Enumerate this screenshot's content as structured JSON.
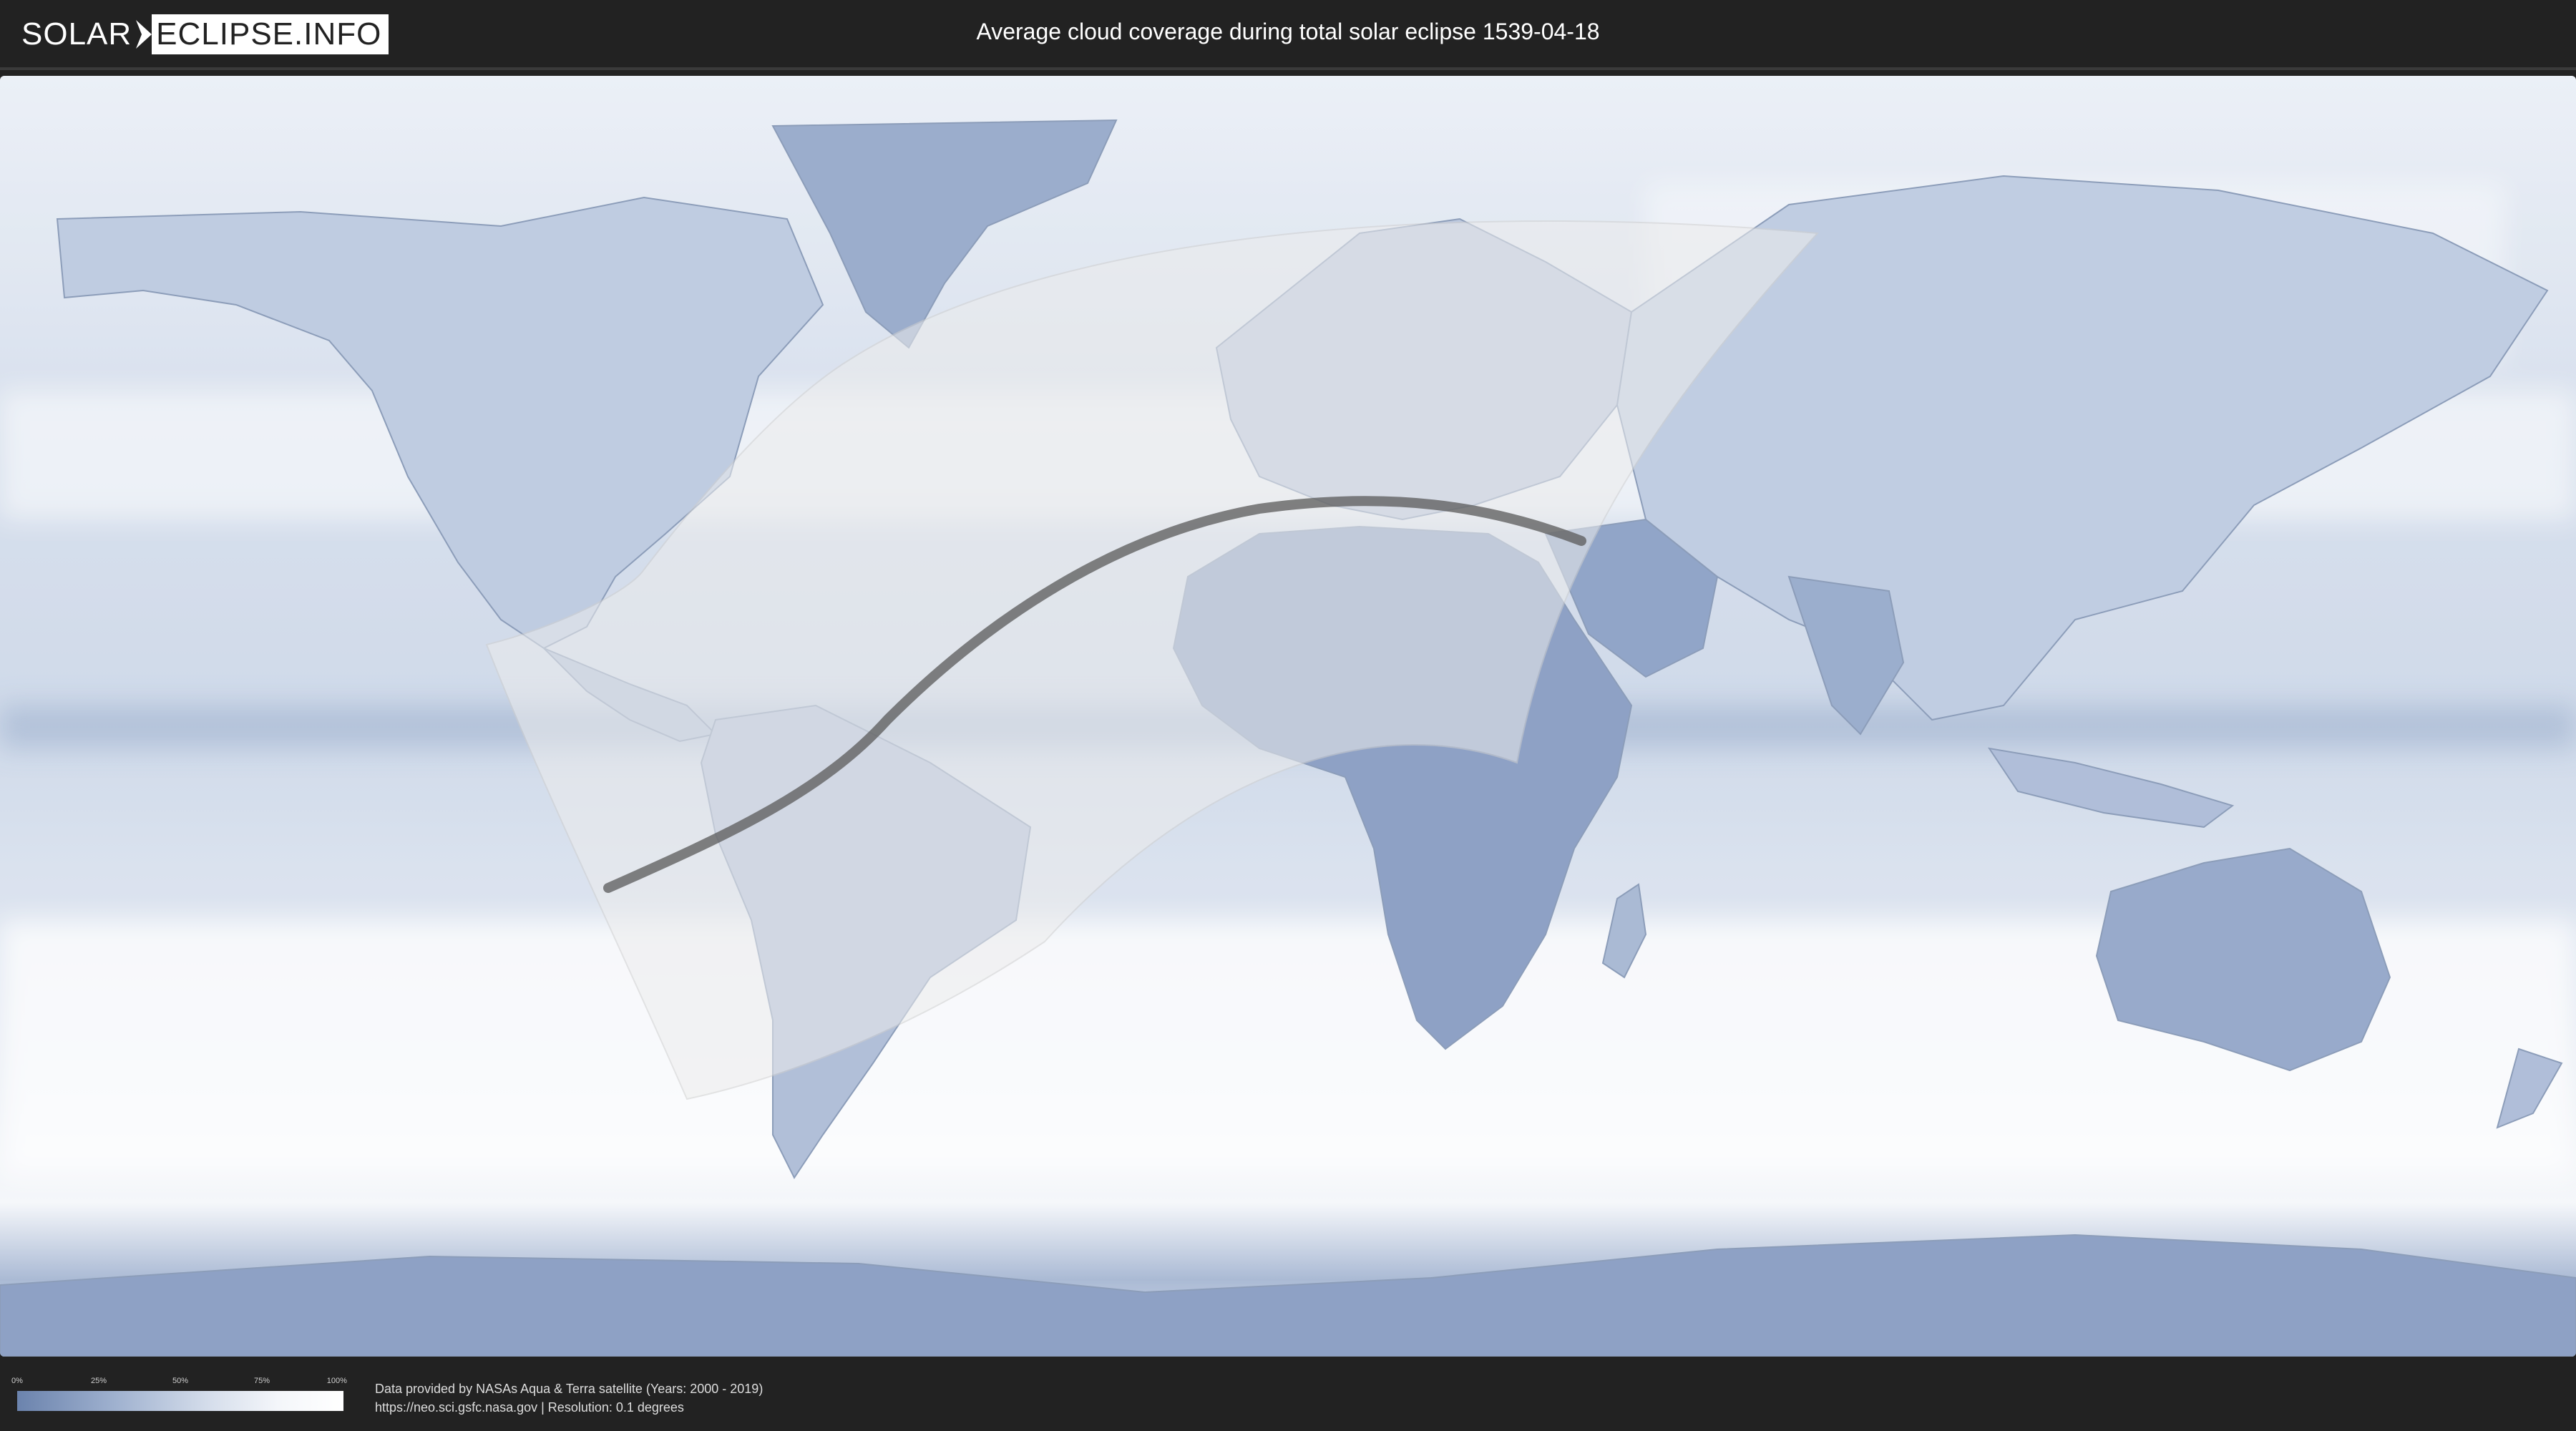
{
  "header": {
    "logo_left": "SOLAR",
    "logo_right": "ECLIPSE.INFO",
    "title": "Average cloud coverage during total solar eclipse 1539-04-18"
  },
  "map": {
    "type": "world-cloud-coverage-map",
    "eclipse_date": "1539-04-18",
    "colors": {
      "clear_sky": "#6b83ad",
      "full_cloud": "#ffffff",
      "eclipse_zone": "#e8e8e8",
      "totality_path": "#555555"
    }
  },
  "footer": {
    "legend": {
      "ticks": [
        "0%",
        "25%",
        "50%",
        "75%",
        "100%"
      ],
      "colors": [
        "#6b83ad",
        "#9fb1cf",
        "#d7dfec",
        "#f4f6fa",
        "#ffffff"
      ]
    },
    "credit_line1": "Data provided by NASAs Aqua & Terra satellite (Years: 2000 - 2019)",
    "credit_line2": "https://neo.sci.gsfc.nasa.gov | Resolution: 0.1 degrees"
  }
}
